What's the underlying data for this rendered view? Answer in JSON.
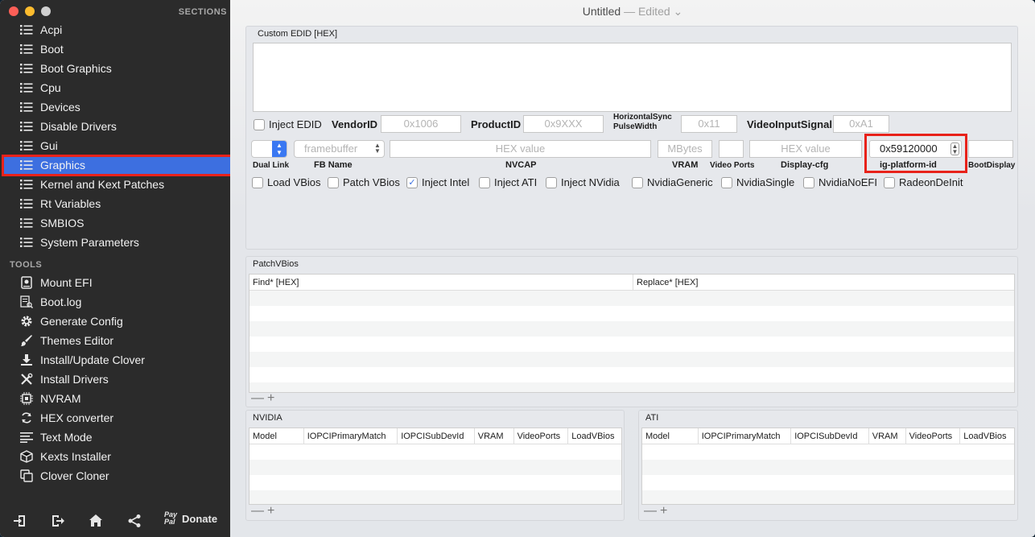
{
  "window": {
    "title": "Untitled",
    "status": "— Edited",
    "status_caret": "⌄"
  },
  "sidebar": {
    "sections_header": "SECTIONS",
    "tools_header": "TOOLS",
    "sections": [
      {
        "label": "Acpi",
        "icon": "list-icon"
      },
      {
        "label": "Boot",
        "icon": "list-icon"
      },
      {
        "label": "Boot Graphics",
        "icon": "list-icon"
      },
      {
        "label": "Cpu",
        "icon": "list-icon"
      },
      {
        "label": "Devices",
        "icon": "list-icon"
      },
      {
        "label": "Disable Drivers",
        "icon": "list-icon"
      },
      {
        "label": "Gui",
        "icon": "list-icon"
      },
      {
        "label": "Graphics",
        "icon": "list-icon",
        "selected": true
      },
      {
        "label": "Kernel and Kext Patches",
        "icon": "list-icon"
      },
      {
        "label": "Rt Variables",
        "icon": "list-icon"
      },
      {
        "label": "SMBIOS",
        "icon": "list-icon"
      },
      {
        "label": "System Parameters",
        "icon": "list-icon"
      }
    ],
    "tools": [
      {
        "label": "Mount EFI",
        "icon": "disk-icon"
      },
      {
        "label": "Boot.log",
        "icon": "log-icon"
      },
      {
        "label": "Generate Config",
        "icon": "gear-icon"
      },
      {
        "label": "Themes Editor",
        "icon": "brush-icon"
      },
      {
        "label": "Install/Update Clover",
        "icon": "download-icon"
      },
      {
        "label": "Install Drivers",
        "icon": "tools-icon"
      },
      {
        "label": "NVRAM",
        "icon": "chip-icon"
      },
      {
        "label": "HEX converter",
        "icon": "refresh-icon"
      },
      {
        "label": "Text Mode",
        "icon": "text-icon"
      },
      {
        "label": "Kexts Installer",
        "icon": "package-icon"
      },
      {
        "label": "Clover Cloner",
        "icon": "clone-icon"
      }
    ],
    "bottom": {
      "donate_label": "Donate",
      "paypal_top": "Pay",
      "paypal_bottom": "Pal"
    }
  },
  "graphics": {
    "custom_edid_label": "Custom EDID [HEX]",
    "inject_edid_label": "Inject EDID",
    "vendor_id_label": "VendorID",
    "vendor_id_placeholder": "0x1006",
    "product_id_label": "ProductID",
    "product_id_placeholder": "0x9XXX",
    "hsync_label_1": "HorizontalSync",
    "hsync_label_2": "PulseWidth",
    "hsync_placeholder": "0x11",
    "video_input_label": "VideoInputSignal",
    "video_input_placeholder": "0xA1",
    "dual_link_label": "Dual Link",
    "fb_name_label": "FB Name",
    "fb_name_placeholder": "framebuffer",
    "nvcap_label": "NVCAP",
    "nvcap_placeholder": "HEX value",
    "vram_label": "VRAM",
    "vram_placeholder": "MBytes",
    "video_ports_label": "Video Ports",
    "display_cfg_label": "Display-cfg",
    "display_cfg_placeholder": "HEX value",
    "ig_platform_label": "ig-platform-id",
    "ig_platform_value": "0x59120000",
    "boot_display_label": "BootDisplay",
    "checkboxes": [
      {
        "label": "Load VBios",
        "checked": false
      },
      {
        "label": "Patch VBios",
        "checked": false
      },
      {
        "label": "Inject Intel",
        "checked": true
      },
      {
        "label": "Inject ATI",
        "checked": false
      },
      {
        "label": "Inject NVidia",
        "checked": false
      },
      {
        "label": "NvidiaGeneric",
        "checked": false
      },
      {
        "label": "NvidiaSingle",
        "checked": false
      },
      {
        "label": "NvidiaNoEFI",
        "checked": false
      },
      {
        "label": "RadeonDeInit",
        "checked": false
      }
    ]
  },
  "patch_vbios": {
    "label": "PatchVBios",
    "columns": [
      "Find* [HEX]",
      "Replace* [HEX]"
    ],
    "minus": "—",
    "plus": "+"
  },
  "nvidia": {
    "label": "NVIDIA",
    "columns": [
      "Model",
      "IOPCIPrimaryMatch",
      "IOPCISubDevId",
      "VRAM",
      "VideoPorts",
      "LoadVBios"
    ]
  },
  "ati": {
    "label": "ATI",
    "columns": [
      "Model",
      "IOPCIPrimaryMatch",
      "IOPCISubDevId",
      "VRAM",
      "VideoPorts",
      "LoadVBios"
    ]
  },
  "colors": {
    "accent": "#3d6fe0",
    "highlight": "#e8221a",
    "sidebar": "#2b2b2b"
  }
}
